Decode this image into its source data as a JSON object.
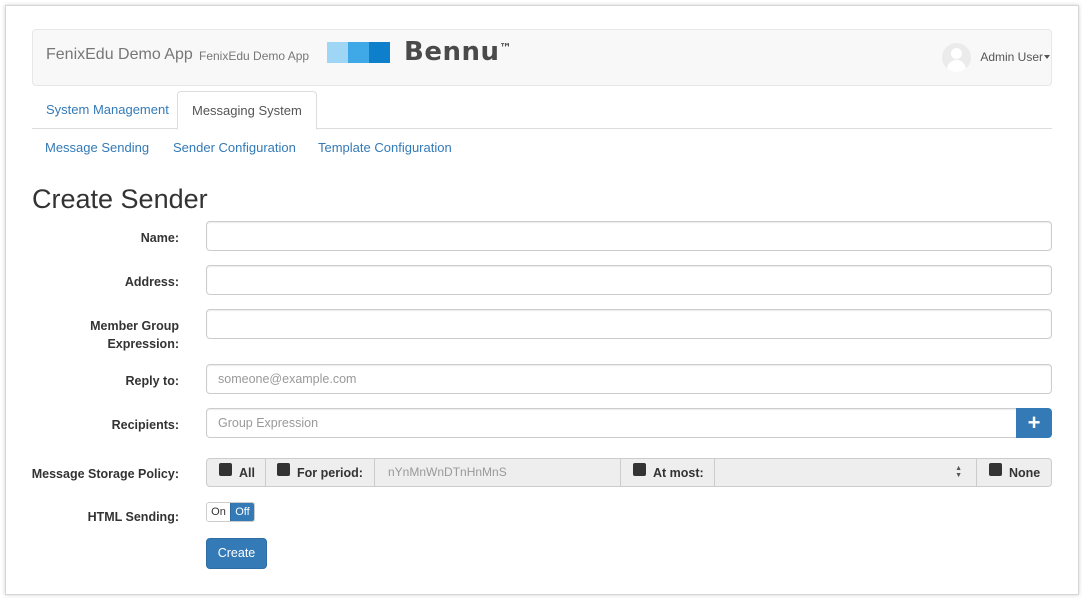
{
  "header": {
    "app_title": "FenixEdu Demo App",
    "app_subtitle": "FenixEdu Demo App",
    "logo_text": "Bennu",
    "logo_tm": "™",
    "logo_colors": [
      "#9fd6f5",
      "#3fa9e8",
      "#0e7fcb"
    ],
    "user_name": "Admin User"
  },
  "tabs": [
    {
      "label": "System Management",
      "active": false
    },
    {
      "label": "Messaging System",
      "active": true
    }
  ],
  "subnav": [
    {
      "label": "Message Sending"
    },
    {
      "label": "Sender Configuration"
    },
    {
      "label": "Template Configuration"
    }
  ],
  "page": {
    "title": "Create Sender"
  },
  "form": {
    "name_label": "Name:",
    "name_value": "",
    "address_label": "Address:",
    "address_value": "",
    "member_group_label_line1": "Member Group",
    "member_group_label_line2": "Expression:",
    "member_group_value": "",
    "reply_to_label": "Reply to:",
    "reply_to_placeholder": "someone@example.com",
    "recipients_label": "Recipients:",
    "recipients_placeholder": "Group Expression",
    "add_recipient_icon": "plus-icon",
    "storage_policy_label": "Message Storage Policy:",
    "storage_all": "All",
    "storage_for_period": "For period:",
    "storage_period_placeholder": "nYnMnWnDTnHnMnS",
    "storage_at_most": "At most:",
    "storage_none": "None",
    "html_sending_label": "HTML Sending:",
    "html_on": "On",
    "html_off": "Off",
    "html_sending_state": "Off",
    "create_button": "Create"
  },
  "colors": {
    "primary": "#337ab7",
    "link": "#337ab7"
  }
}
